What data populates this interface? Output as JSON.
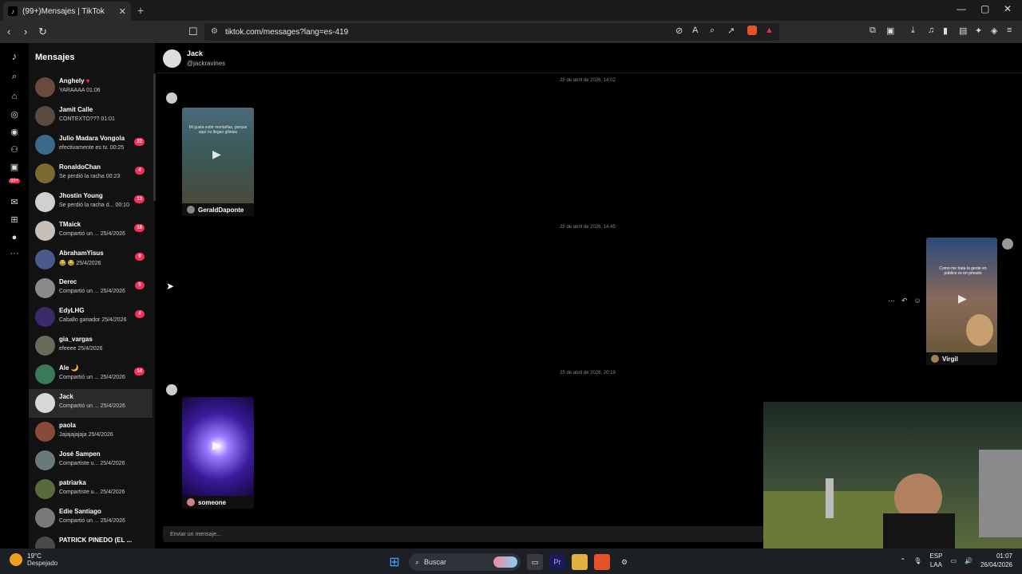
{
  "browser": {
    "tab_title": "(99+)Mensajes | TikTok",
    "tab_close": "✕",
    "new_tab": "+",
    "url": "tiktok.com/messages?lang=es-419",
    "win_min": "—",
    "win_max": "▢",
    "win_close": "✕"
  },
  "rail": {
    "badge": "99+"
  },
  "sidebar": {
    "title": "Mensajes",
    "conversations": [
      {
        "name": "Anghely",
        "preview": "YARAAAA",
        "time": "01:06",
        "badge": "",
        "heart": "♥",
        "color": "#6b4a3e"
      },
      {
        "name": "Jamit Calle",
        "preview": "CONTEXTO???",
        "time": "01:01",
        "badge": "",
        "color": "#5a4a40"
      },
      {
        "name": "Julio Madara Vongola",
        "preview": "efectivamente es tv.",
        "time": "00:25",
        "badge": "22",
        "color": "#3a6a8a"
      },
      {
        "name": "RonaldoChan",
        "preview": "Se perdió la racha",
        "time": "00:23",
        "badge": "4",
        "color": "#7a6a30"
      },
      {
        "name": "Jhostin Young",
        "preview": "Se perdió la racha d...",
        "time": "00:10",
        "badge": "13",
        "color": "#d0d0d0"
      },
      {
        "name": "TMaick",
        "preview": "Compartió un ...",
        "time": "25/4/2026",
        "badge": "18",
        "color": "#c8c0b8"
      },
      {
        "name": "AbrahamYisus",
        "preview": "😂 😂",
        "time": "25/4/2026",
        "badge": "9",
        "color": "#4a5a8a"
      },
      {
        "name": "Derec",
        "preview": "Compartió un ...",
        "time": "25/4/2026",
        "badge": "5",
        "color": "#8a8a8a"
      },
      {
        "name": "EdyLHG",
        "preview": "Caballo ganador",
        "time": "25/4/2026",
        "badge": "4",
        "color": "#3a2a6a"
      },
      {
        "name": "gia_vargas",
        "preview": "efeeee",
        "time": "25/4/2026",
        "badge": "",
        "color": "#6a6a5a"
      },
      {
        "name": "Ale 🌙",
        "preview": "Compartió un ...",
        "time": "25/4/2026",
        "badge": "14",
        "color": "#3a7a5a"
      },
      {
        "name": "Jack",
        "preview": "Compartió un ...",
        "time": "25/4/2026",
        "badge": "",
        "color": "#d8d8d8"
      },
      {
        "name": "paola",
        "preview": "Jajajajajaja",
        "time": "25/4/2026",
        "badge": "",
        "color": "#8a4a3a"
      },
      {
        "name": "José Sampen",
        "preview": "Compartiste u...",
        "time": "25/4/2026",
        "badge": "",
        "color": "#6a7a7a"
      },
      {
        "name": "patriarka",
        "preview": "Compartiste u...",
        "time": "25/4/2026",
        "badge": "",
        "color": "#5a6a3a"
      },
      {
        "name": "Edie Santiago",
        "preview": "Compartió un ...",
        "time": "25/4/2026",
        "badge": "",
        "color": "#7a7a7a"
      },
      {
        "name": "PATRICK PINEDO (EL ...",
        "preview": "",
        "time": "",
        "badge": "",
        "color": "#4a4a4a"
      }
    ]
  },
  "chat": {
    "name": "Jack",
    "handle": "@jackravines",
    "input_placeholder": "Enviar un mensaje...",
    "timestamps": [
      "25 de abril de 2026, 14:02",
      "25 de abril de 2026, 14:45",
      "25 de abril de 2026, 20:19"
    ],
    "videos": [
      {
        "caption": "Mi gusta subir montañas, porque aquí no llegan gilintas",
        "author": "GeraldDaponte"
      },
      {
        "caption": "Como me trata la gente en público vs en privado",
        "author": "Virgil"
      },
      {
        "caption": "",
        "author": "someone"
      }
    ],
    "actions": [
      "···",
      "↶",
      "☺"
    ]
  },
  "taskbar": {
    "temp": "19°C",
    "weather": "Despejado",
    "search": "Buscar",
    "lang1": "ESP",
    "lang2": "LAA",
    "time": "01:07",
    "date": "26/04/2026"
  }
}
